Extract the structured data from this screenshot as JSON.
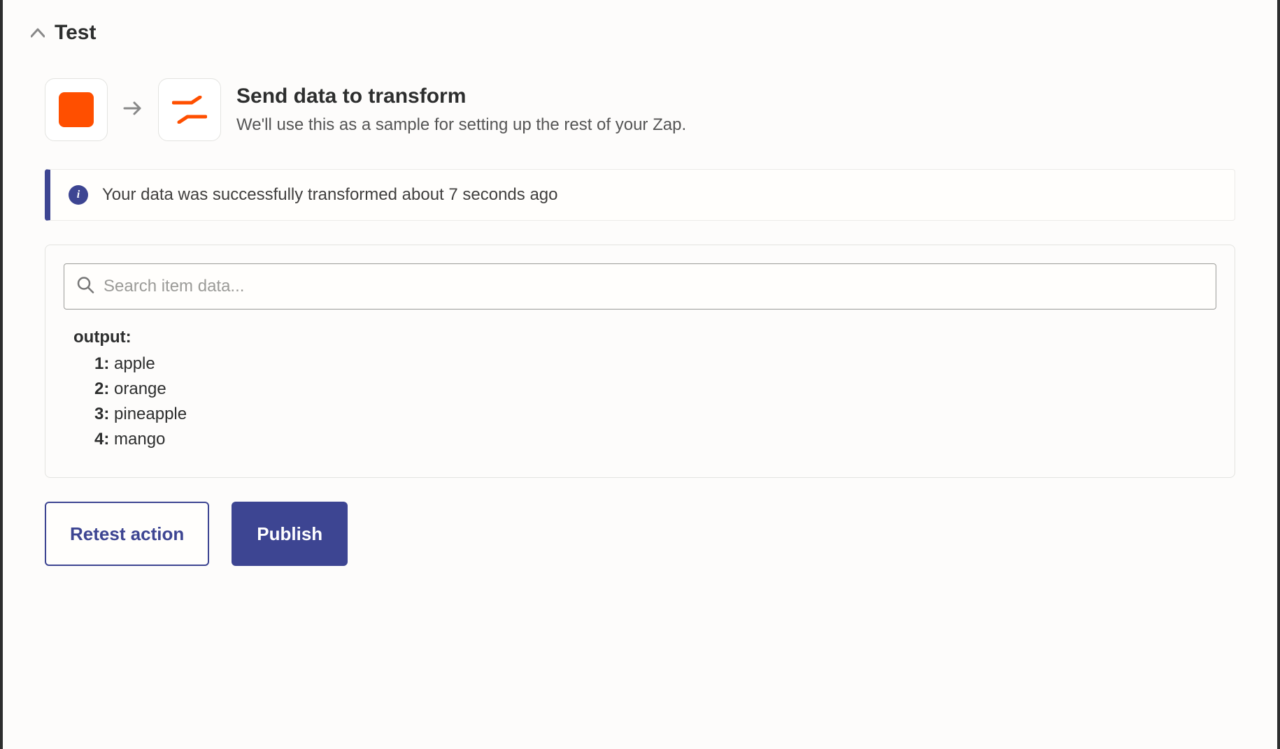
{
  "section": {
    "title": "Test"
  },
  "header": {
    "title": "Send data to transform",
    "subtitle": "We'll use this as a sample for setting up the rest of your Zap."
  },
  "alert": {
    "message": "Your data was successfully transformed about 7 seconds ago"
  },
  "search": {
    "placeholder": "Search item data..."
  },
  "output": {
    "label": "output:",
    "items": [
      {
        "index": "1:",
        "value": "apple"
      },
      {
        "index": "2:",
        "value": "orange"
      },
      {
        "index": "3:",
        "value": "pineapple"
      },
      {
        "index": "4:",
        "value": "mango"
      }
    ]
  },
  "buttons": {
    "retest": "Retest action",
    "publish": "Publish"
  },
  "colors": {
    "accent": "#3d4592",
    "brand_orange": "#ff4f00"
  }
}
